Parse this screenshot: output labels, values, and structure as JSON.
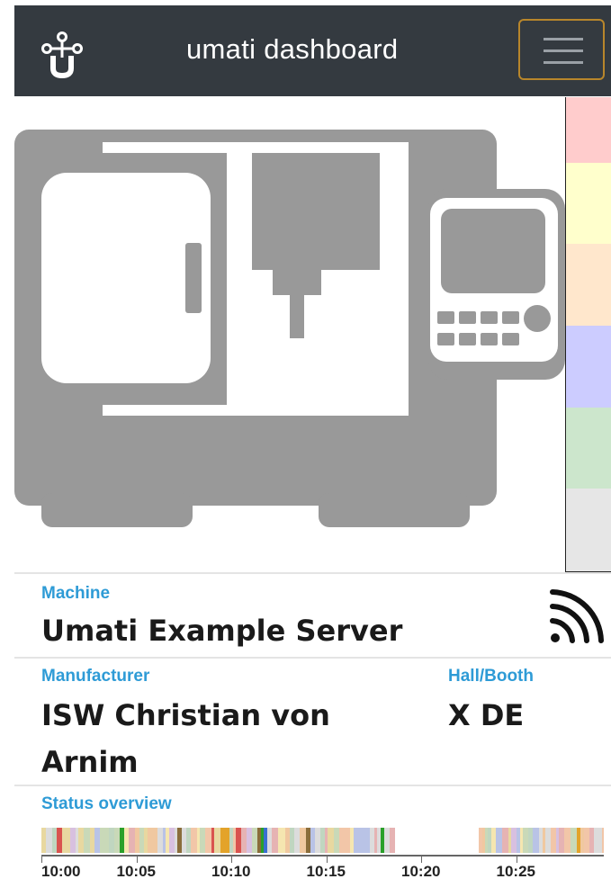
{
  "navbar": {
    "title": "umati dashboard",
    "menu_icon": "hamburger-menu-icon",
    "logo_icon": "umati-logo-icon"
  },
  "status_colors": [
    "#ffcccc",
    "#ffffcc",
    "#ffe7cc",
    "#ccccff",
    "#cce6cc",
    "#e6e6e6"
  ],
  "machine": {
    "label": "Machine",
    "value": "Umati Example Server",
    "connection_icon": "wifi-signal-icon"
  },
  "manufacturer": {
    "label": "Manufacturer",
    "value_line1": "ISW Christian von",
    "value_line2": "Arnim"
  },
  "hall_booth": {
    "label": "Hall/Booth",
    "value": "X DE"
  },
  "status_overview": {
    "label": "Status overview",
    "ticks": [
      "10:00",
      "10:05",
      "10:10",
      "10:15",
      "10:20",
      "10:25"
    ]
  }
}
